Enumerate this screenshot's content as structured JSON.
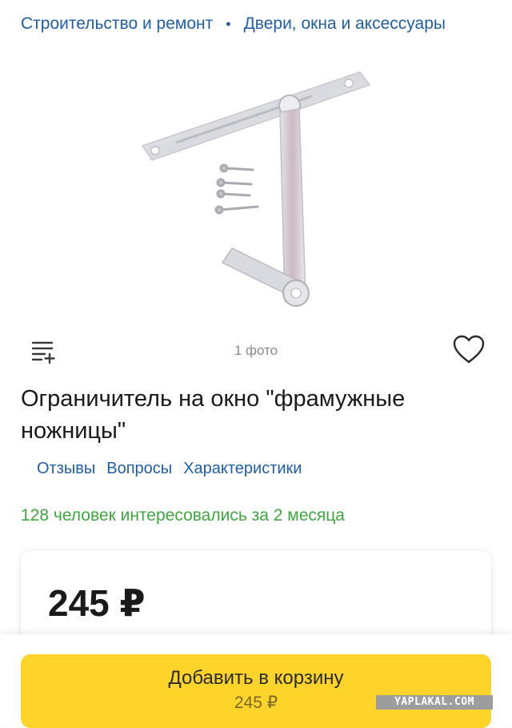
{
  "breadcrumbs": {
    "items": [
      "Строительство и ремонт",
      "Двери, окна и аксессуары"
    ],
    "separator": "•"
  },
  "gallery": {
    "photo_count": "1 фото"
  },
  "product": {
    "title": "Ограничитель на окно \"фрамужные ножницы\""
  },
  "tabs": [
    "Отзывы",
    "Вопросы",
    "Характеристики"
  ],
  "interest_text": "128 человек интересовались за 2 месяца",
  "price": {
    "value": "245 ₽"
  },
  "cart_button": {
    "label": "Добавить в корзину",
    "price": "245 ₽"
  },
  "watermark": "YAPLAKAL.COM",
  "colors": {
    "link": "#1f5ea8",
    "interest": "#3ea83f",
    "cart_button": "#fed42b"
  },
  "icons": [
    "list-add-icon",
    "heart-icon"
  ]
}
